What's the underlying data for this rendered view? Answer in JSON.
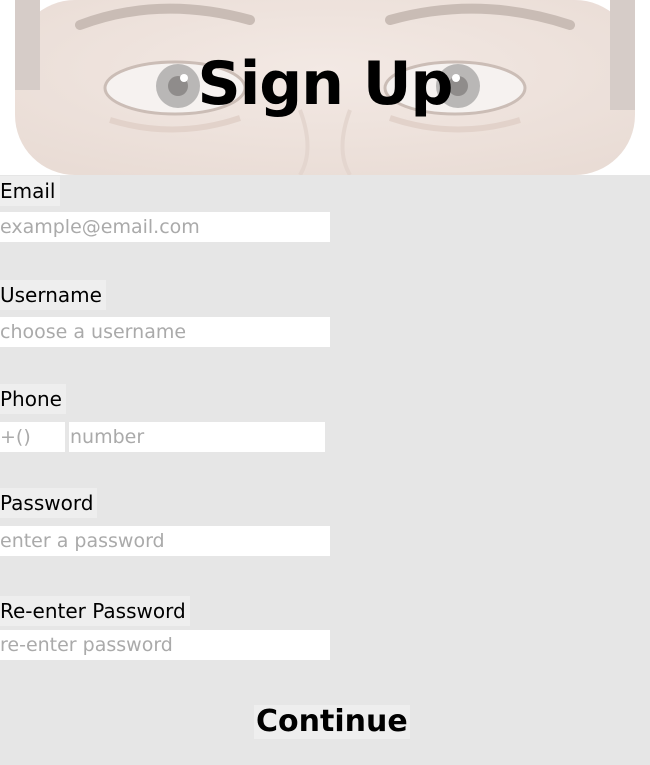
{
  "header": {
    "title": "Sign Up"
  },
  "form": {
    "email": {
      "label": "Email",
      "placeholder": "example@email.com"
    },
    "username": {
      "label": "Username",
      "placeholder": "choose a username"
    },
    "phone": {
      "label": "Phone",
      "code_placeholder": "+()",
      "number_placeholder": "number"
    },
    "password": {
      "label": "Password",
      "placeholder": "enter a password"
    },
    "reenter_password": {
      "label": "Re-enter Password",
      "placeholder": "re-enter password"
    }
  },
  "actions": {
    "continue_label": "Continue"
  },
  "colors": {
    "page_background": "#e6e6e6",
    "input_background": "#ffffff",
    "placeholder": "#aaaaaa",
    "text": "#000000"
  }
}
